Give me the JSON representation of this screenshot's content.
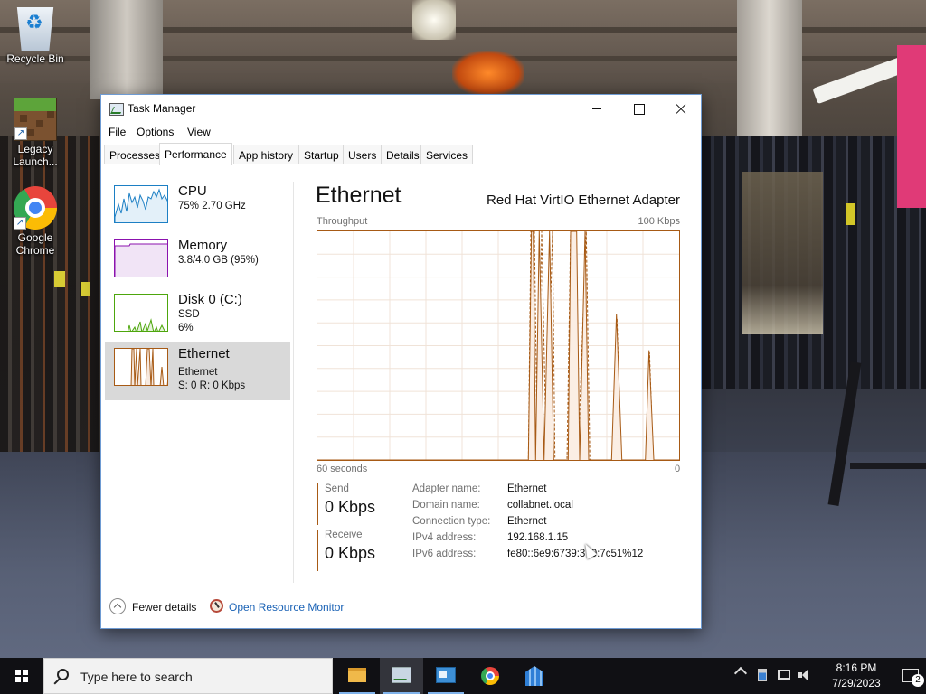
{
  "desktop": {
    "icons": [
      {
        "label": "Recycle Bin",
        "icon": "recycle-bin-icon"
      },
      {
        "label": "Legacy Launch...",
        "icon": "minecraft-launcher-icon"
      },
      {
        "label": "Google Chrome",
        "icon": "chrome-icon"
      }
    ]
  },
  "window": {
    "title": "Task Manager",
    "menu": [
      "File",
      "Options",
      "View"
    ],
    "tabs": [
      "Processes",
      "Performance",
      "App history",
      "Startup",
      "Users",
      "Details",
      "Services"
    ],
    "active_tab": "Performance"
  },
  "perf_list": [
    {
      "name": "CPU",
      "sub1": "75% 2.70 GHz",
      "sub2": "",
      "color": "#1c7fc4"
    },
    {
      "name": "Memory",
      "sub1": "3.8/4.0 GB (95%)",
      "sub2": "",
      "color": "#8b12ae"
    },
    {
      "name": "Disk 0 (C:)",
      "sub1": "SSD",
      "sub2": "6%",
      "color": "#4da60c"
    },
    {
      "name": "Ethernet",
      "sub1": "Ethernet",
      "sub2": "S: 0 R: 0 Kbps",
      "color": "#a75a15",
      "selected": true
    }
  ],
  "detail": {
    "title": "Ethernet",
    "adapter": "Red Hat VirtIO Ethernet Adapter",
    "graph_label": "Throughput",
    "graph_max": "100 Kbps",
    "graph_span": "60 seconds",
    "graph_min": "0",
    "send_label": "Send",
    "send_value": "0 Kbps",
    "receive_label": "Receive",
    "receive_value": "0 Kbps",
    "info": [
      {
        "key": "Adapter name:",
        "value": "Ethernet"
      },
      {
        "key": "Domain name:",
        "value": "collabnet.local"
      },
      {
        "key": "Connection type:",
        "value": "Ethernet"
      },
      {
        "key": "IPv4 address:",
        "value": "192.168.1.15"
      },
      {
        "key": "IPv6 address:",
        "value": "fe80::6e9:6739:3 :0:7c51%12"
      }
    ],
    "accent_color": "#a75a15"
  },
  "chart_data": {
    "type": "line",
    "title": "Throughput",
    "xlabel": "60 seconds",
    "ylabel": "",
    "xlim": [
      60,
      0
    ],
    "ylim": [
      0,
      100
    ],
    "series": [
      {
        "name": "Send",
        "style": "dashed",
        "points": [
          [
            60,
            0
          ],
          [
            25,
            0
          ],
          [
            24.6,
            100
          ],
          [
            24,
            100
          ],
          [
            23.5,
            0
          ],
          [
            22.8,
            100
          ],
          [
            22,
            0
          ],
          [
            21,
            100
          ],
          [
            20.6,
            0
          ],
          [
            18.6,
            0
          ],
          [
            18,
            100
          ],
          [
            17.2,
            100
          ],
          [
            16.8,
            0
          ],
          [
            15.4,
            100
          ],
          [
            14.8,
            0
          ],
          [
            11,
            0
          ],
          [
            10.3,
            62
          ],
          [
            9.6,
            0
          ],
          [
            5.5,
            0
          ],
          [
            4.9,
            47
          ],
          [
            4.3,
            0
          ],
          [
            0,
            0
          ]
        ]
      },
      {
        "name": "Receive",
        "style": "solid",
        "points": [
          [
            60,
            0
          ],
          [
            25,
            0
          ],
          [
            24.5,
            100
          ],
          [
            24.2,
            100
          ],
          [
            23.8,
            0
          ],
          [
            23.2,
            100
          ],
          [
            22.4,
            0
          ],
          [
            21.5,
            100
          ],
          [
            20.8,
            0
          ],
          [
            18.4,
            0
          ],
          [
            18,
            100
          ],
          [
            17,
            100
          ],
          [
            16.5,
            0
          ],
          [
            15.6,
            100
          ],
          [
            15,
            0
          ],
          [
            11.2,
            0
          ],
          [
            10.4,
            64
          ],
          [
            9.5,
            0
          ],
          [
            5.6,
            0
          ],
          [
            5,
            48
          ],
          [
            4.2,
            0
          ],
          [
            0,
            0
          ]
        ]
      }
    ]
  },
  "footer": {
    "fewer_details": "Fewer details",
    "open_rm": "Open Resource Monitor"
  },
  "taskbar": {
    "search_placeholder": "Type here to search",
    "apps": [
      "file-explorer-icon",
      "task-manager-icon",
      "control-panel-icon",
      "chrome-icon",
      "kubernetes-icon"
    ],
    "time": "8:16 PM",
    "date": "7/29/2023",
    "notifications": "2"
  }
}
